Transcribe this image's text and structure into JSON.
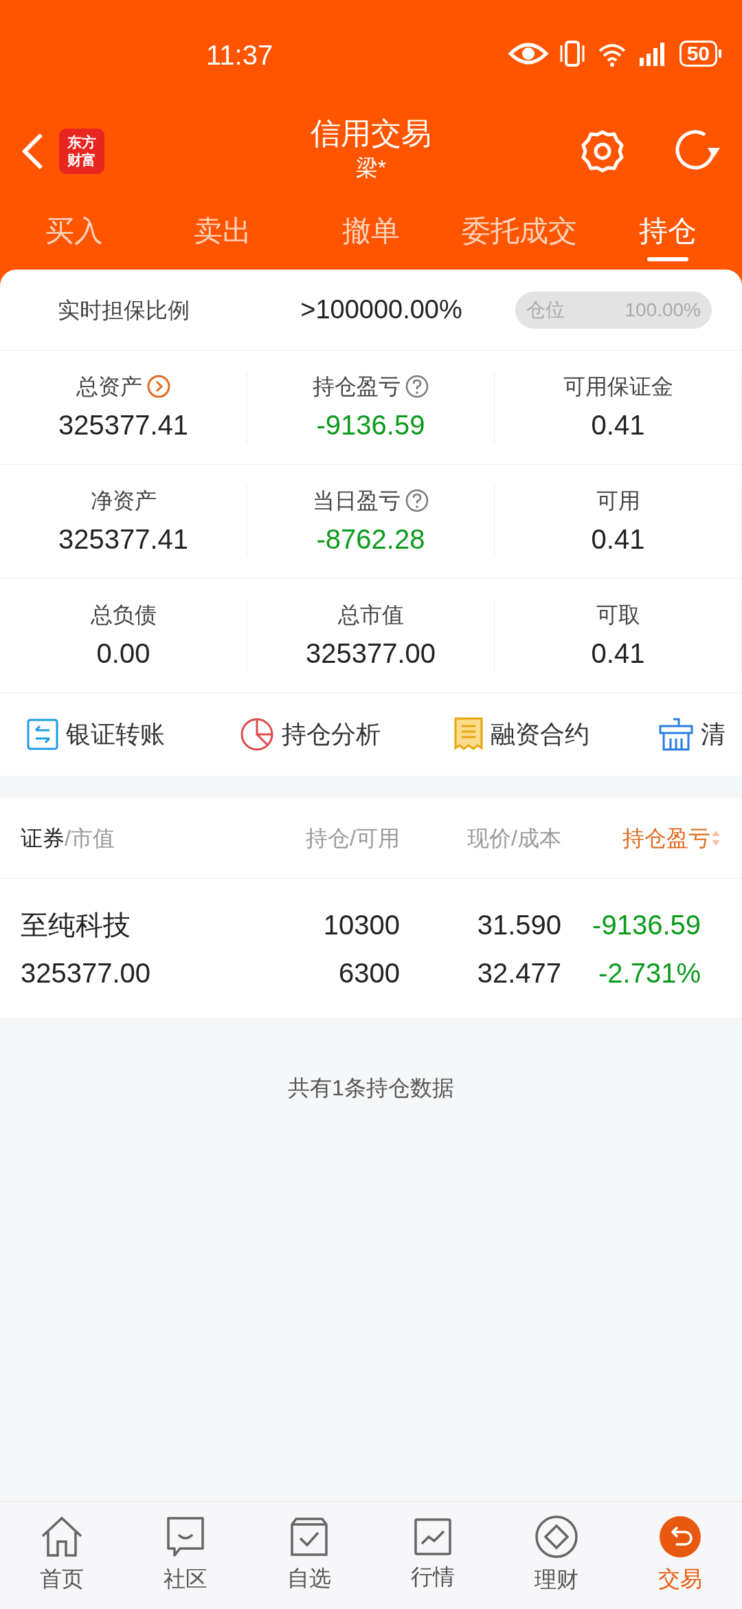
{
  "status_bar": {
    "time": "11:37",
    "battery": "50"
  },
  "header": {
    "logo": [
      "东方",
      "财富"
    ],
    "title": "信用交易",
    "subtitle": "梁*"
  },
  "tabs": [
    {
      "label": "买入",
      "selected": false
    },
    {
      "label": "卖出",
      "selected": false
    },
    {
      "label": "撤单",
      "selected": false
    },
    {
      "label": "委托成交",
      "selected": false
    },
    {
      "label": "持仓",
      "selected": true
    }
  ],
  "ratio": {
    "label": "实时担保比例",
    "value": ">100000.00%",
    "position_label": "仓位",
    "position_value": "100.00%"
  },
  "metrics": [
    [
      {
        "label": "总资产",
        "value": "325377.41",
        "kind": "link",
        "loss": false
      },
      {
        "label": "持仓盈亏",
        "value": "-9136.59",
        "kind": "help",
        "loss": true
      },
      {
        "label": "可用保证金",
        "value": "0.41",
        "kind": "plain",
        "loss": false
      }
    ],
    [
      {
        "label": "净资产",
        "value": "325377.41",
        "kind": "plain",
        "loss": false
      },
      {
        "label": "当日盈亏",
        "value": "-8762.28",
        "kind": "help",
        "loss": true
      },
      {
        "label": "可用",
        "value": "0.41",
        "kind": "plain",
        "loss": false
      }
    ],
    [
      {
        "label": "总负债",
        "value": "0.00",
        "kind": "plain",
        "loss": false
      },
      {
        "label": "总市值",
        "value": "325377.00",
        "kind": "plain",
        "loss": false
      },
      {
        "label": "可取",
        "value": "0.41",
        "kind": "plain",
        "loss": false
      }
    ]
  ],
  "actions": [
    {
      "label": "银证转账",
      "kind": "transfer"
    },
    {
      "label": "持仓分析",
      "kind": "pie"
    },
    {
      "label": "融资合约",
      "kind": "contract"
    },
    {
      "label": "清",
      "kind": "broom"
    }
  ],
  "table": {
    "columns": [
      {
        "primary": "证券",
        "secondary": "/市值",
        "sorted": false
      },
      {
        "primary": "持仓/可用",
        "sorted": false
      },
      {
        "primary": "现价/成本",
        "sorted": false
      },
      {
        "primary": "持仓盈亏",
        "sorted": true
      }
    ],
    "rows": [
      {
        "name": "至纯科技",
        "market_value": "325377.00",
        "holding": "10300",
        "available": "6300",
        "price": "31.590",
        "cost": "32.477",
        "pnl": "-9136.59",
        "pnl_pct": "-2.731%",
        "loss": true
      }
    ],
    "footer": "共有1条持仓数据"
  },
  "nav": [
    {
      "label": "首页",
      "kind": "home",
      "selected": false
    },
    {
      "label": "社区",
      "kind": "chat",
      "selected": false
    },
    {
      "label": "自选",
      "kind": "check",
      "selected": false
    },
    {
      "label": "行情",
      "kind": "chart",
      "selected": false
    },
    {
      "label": "理财",
      "kind": "diamond",
      "selected": false
    },
    {
      "label": "交易",
      "kind": "trade",
      "selected": true
    }
  ]
}
